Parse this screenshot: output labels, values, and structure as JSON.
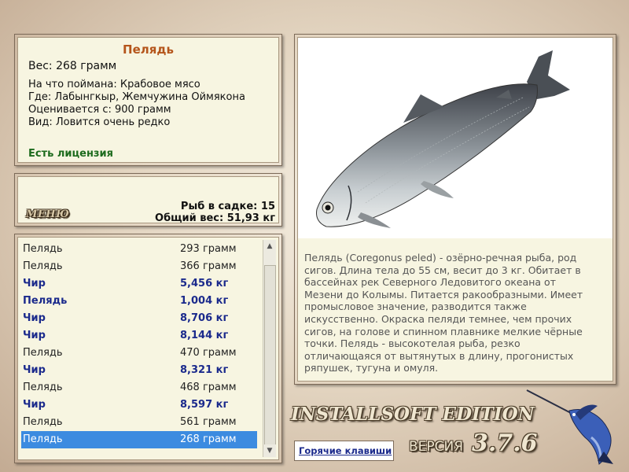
{
  "fish": {
    "title": "Пелядь",
    "weight": "Вес: 268 грамм",
    "bait": "На что поймана: Крабовое мясо",
    "location": "Где: Лабынгкыр, Жемчужина Оймякона",
    "value": "Оценивается с: 900 грамм",
    "rarity": "Вид: Ловится очень редко",
    "license": "Есть лицензия",
    "description": "Пелядь (Coregonus peled) - озёрно-речная рыба, род сигов. Длина тела до 55 см, весит до 3 кг. Обитает в бассейнах рек Северного Ледовитого океана от Мезени до Колымы. Питается ракообразными. Имеет промысловое значение, разводится также искусственно. Окраска пеляди темнее, чем прочих сигов, на голове и спинном плавнике мелкие чёрные точки. Пелядь - высокотелая рыба, резко отличающаяся от вытянутых в длину, прогонистых ряпушек, тугуна и омуля."
  },
  "cage": {
    "menu_label": "МЕНЮ",
    "count": "Рыб в садке: 15",
    "total": "Общий вес: 51,93 кг"
  },
  "catch_list": [
    {
      "name": "Пелядь",
      "weight": "293 грамм",
      "bold": false,
      "selected": false
    },
    {
      "name": "Пелядь",
      "weight": "366 грамм",
      "bold": false,
      "selected": false
    },
    {
      "name": "Чир",
      "weight": "5,456 кг",
      "bold": true,
      "selected": false
    },
    {
      "name": "Пелядь",
      "weight": "1,004 кг",
      "bold": true,
      "selected": false
    },
    {
      "name": "Чир",
      "weight": "8,706 кг",
      "bold": true,
      "selected": false
    },
    {
      "name": "Чир",
      "weight": "8,144 кг",
      "bold": true,
      "selected": false
    },
    {
      "name": "Пелядь",
      "weight": "470 грамм",
      "bold": false,
      "selected": false
    },
    {
      "name": "Чир",
      "weight": "8,321 кг",
      "bold": true,
      "selected": false
    },
    {
      "name": "Пелядь",
      "weight": "468 грамм",
      "bold": false,
      "selected": false
    },
    {
      "name": "Чир",
      "weight": "8,597 кг",
      "bold": true,
      "selected": false
    },
    {
      "name": "Пелядь",
      "weight": "561 грамм",
      "bold": false,
      "selected": false
    },
    {
      "name": "Пелядь",
      "weight": "268 грамм",
      "bold": false,
      "selected": true
    }
  ],
  "footer": {
    "edition": "INSTALLSOFT EDITION",
    "hotkeys": "Горячие клавиши",
    "version_label": "ВЕРСИЯ",
    "version_number": "3.7.6"
  },
  "icons": {
    "fish_picture": "peled-fish-image",
    "logo": "marlin-logo"
  },
  "colors": {
    "title": "#b5551b",
    "license": "#1d6b1d",
    "bold_row": "#1b2a8c",
    "selected_row": "#3c8be0"
  }
}
